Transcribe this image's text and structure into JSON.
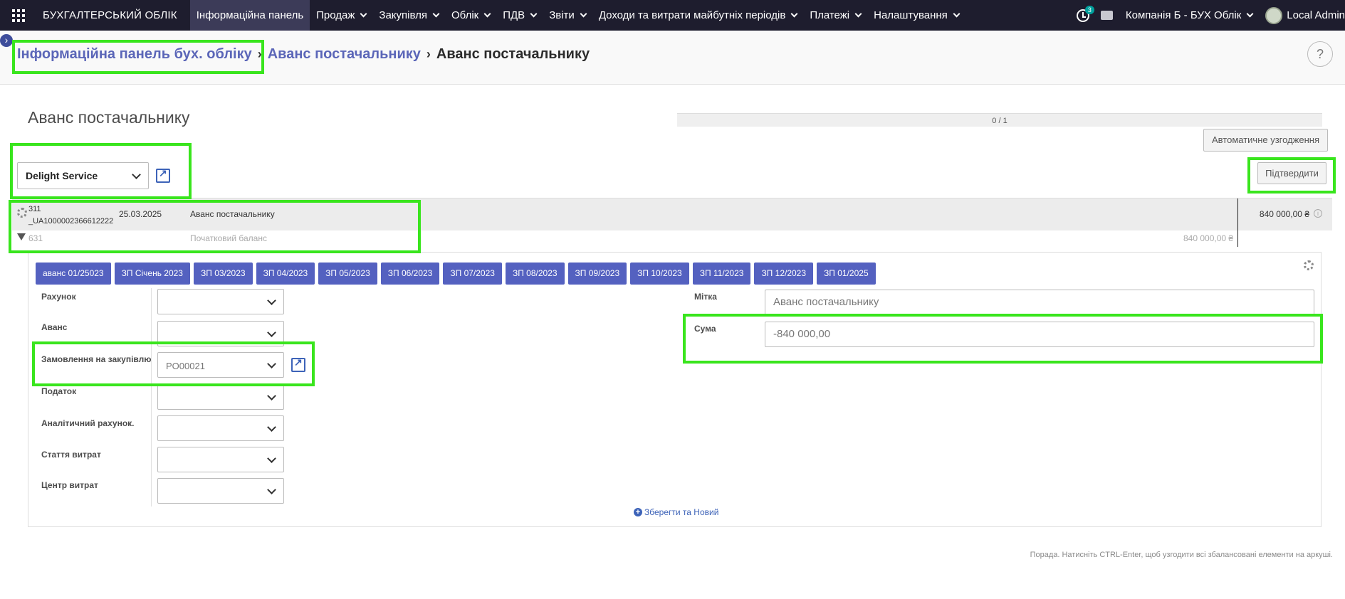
{
  "topbar": {
    "brand": "БУХГАЛТЕРСЬКИЙ ОБЛІК",
    "menu": [
      {
        "label": "Інформаційна панель",
        "active": true,
        "dropdown": false
      },
      {
        "label": "Продаж",
        "dropdown": true
      },
      {
        "label": "Закупівля",
        "dropdown": true
      },
      {
        "label": "Облік",
        "dropdown": true
      },
      {
        "label": "ПДВ",
        "dropdown": true
      },
      {
        "label": "Звіти",
        "dropdown": true
      },
      {
        "label": "Доходи та витрати майбутніх періодів",
        "dropdown": true
      },
      {
        "label": "Платежі",
        "dropdown": true
      },
      {
        "label": "Налаштування",
        "dropdown": true
      }
    ],
    "activity_badge": "3",
    "company": "Компанія Б - БУХ Облік",
    "user": "Local Admin"
  },
  "breadcrumb": {
    "root": "Інформаційна панель бух. обліку",
    "parent": "Аванс постачальнику",
    "current": "Аванс постачальнику"
  },
  "help_label": "?",
  "page_title": "Аванс постачальнику",
  "progress": {
    "text": "0 / 1",
    "value": 0
  },
  "buttons": {
    "auto_reconcile": "Автоматичне узгодження",
    "confirm": "Підтвердити"
  },
  "partner": "Delight Service",
  "statement_line": {
    "code_line1": "311",
    "code_line2": "_UA1000002366612222",
    "date": "25.03.2025",
    "label": "Аванс постачальнику",
    "amount": "840 000,00 ₴"
  },
  "open_balance": {
    "code": "631",
    "label": "Початковий баланс",
    "amount": "840 000,00 ₴"
  },
  "models": [
    "аванс 01/25023",
    "ЗП Січень 2023",
    "ЗП 03/2023",
    "ЗП 04/2023",
    "ЗП 05/2023",
    "ЗП 06/2023",
    "ЗП 07/2023",
    "ЗП 08/2023",
    "ЗП 09/2023",
    "ЗП 10/2023",
    "ЗП 11/2023",
    "ЗП 12/2023",
    "ЗП 01/2025"
  ],
  "form": {
    "account_label": "Рахунок",
    "advance_label": "Аванс",
    "purchase_order_label": "Замовлення на закупівлю",
    "purchase_order_value": "PO00021",
    "tax_label": "Податок",
    "analytic_label": "Аналітичний рахунок.",
    "expense_item_label": "Стаття витрат",
    "cost_center_label": "Центр витрат",
    "tag_label": "Мітка",
    "tag_placeholder": "Аванс постачальнику",
    "amount_label": "Сума",
    "amount_value": "-840 000,00"
  },
  "save_new": "Зберегти та Новий",
  "hint": "Порада. Натисніть CTRL-Enter, щоб узгодити всі збалансовані елементи на аркуші.",
  "highlight_color": "#39e51d",
  "accent_color": "#5461c0"
}
